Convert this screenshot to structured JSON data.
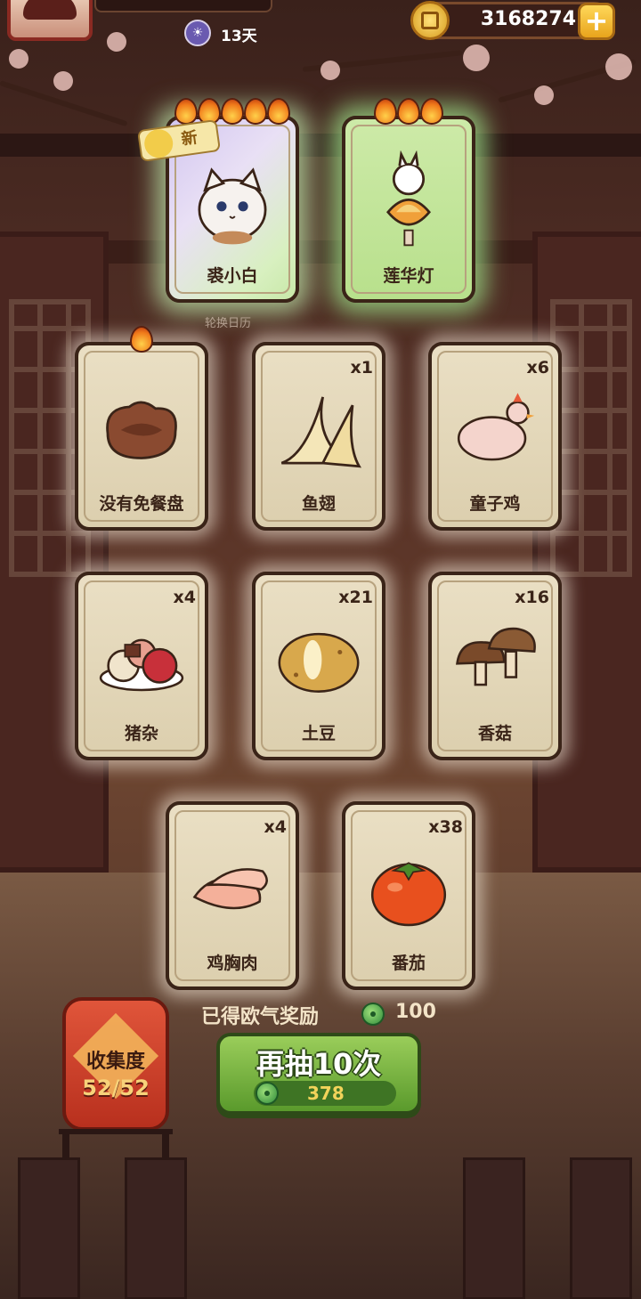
{
  "top_bar": {
    "days": "13天",
    "currency": "3168274",
    "plus_label": "+"
  },
  "banner_caption": "轮换日历",
  "new_badge": "新",
  "cards": [
    {
      "name": "裘小白",
      "qty": "",
      "flames": 5,
      "icon": "white-cat-icon",
      "glow": "rainbow"
    },
    {
      "name": "莲华灯",
      "qty": "",
      "flames": 3,
      "icon": "lotus-lantern-icon",
      "glow": "green"
    },
    {
      "name": "没有免餐盘",
      "qty": "",
      "flames": 1,
      "icon": "brown-plate-icon",
      "glow": "white"
    },
    {
      "name": "鱼翅",
      "qty": "x1",
      "flames": 0,
      "icon": "shark-fin-icon",
      "glow": "white"
    },
    {
      "name": "童子鸡",
      "qty": "x6",
      "flames": 0,
      "icon": "young-chicken-icon",
      "glow": "white"
    },
    {
      "name": "猪杂",
      "qty": "x4",
      "flames": 0,
      "icon": "pork-offal-icon",
      "glow": "white"
    },
    {
      "name": "土豆",
      "qty": "x21",
      "flames": 0,
      "icon": "potato-icon",
      "glow": "white"
    },
    {
      "name": "香菇",
      "qty": "x16",
      "flames": 0,
      "icon": "shiitake-mushroom-icon",
      "glow": "white"
    },
    {
      "name": "鸡胸肉",
      "qty": "x4",
      "flames": 0,
      "icon": "chicken-breast-icon",
      "glow": "white"
    },
    {
      "name": "番茄",
      "qty": "x38",
      "flames": 0,
      "icon": "tomato-icon",
      "glow": "white"
    }
  ],
  "reward": {
    "label": "已得欧气奖励",
    "value": "100"
  },
  "draw_button": {
    "label": "再抽10次",
    "cost": "378"
  },
  "collection": {
    "label": "收集度",
    "progress": "52/52"
  },
  "colors": {
    "accent_green": "#5a9a2c",
    "lantern_red": "#c8402a",
    "card_bg": "#e6dabd",
    "gold": "#f2d35a"
  }
}
